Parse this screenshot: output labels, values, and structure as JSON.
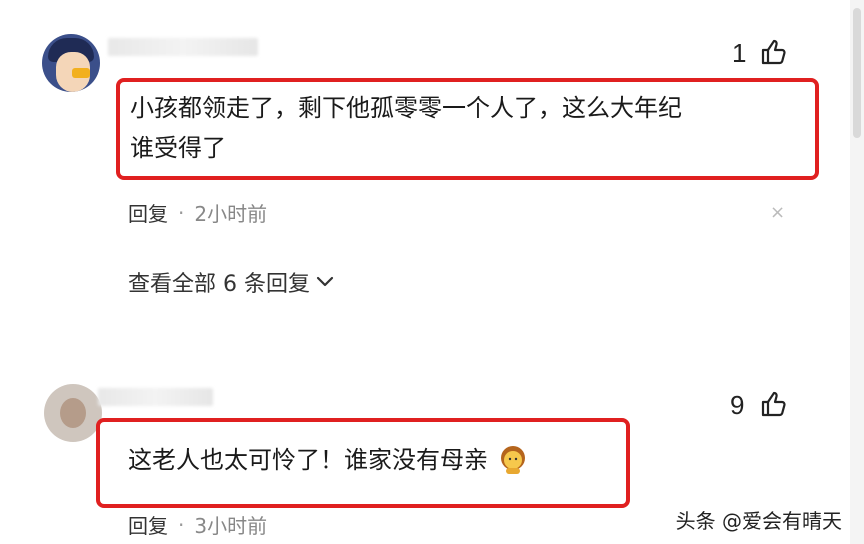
{
  "comments": [
    {
      "likes": "1",
      "text_line1": "小孩都领走了，剩下他孤零零一个人了，这么大年纪",
      "text_line2": "谁受得了",
      "reply_label": "回复",
      "separator": "·",
      "time": "2小时前",
      "close_icon": "×",
      "view_replies": "查看全部 6 条回复"
    },
    {
      "likes": "9",
      "text": "这老人也太可怜了！谁家没有母亲",
      "reply_label": "回复",
      "separator": "·",
      "time": "3小时前"
    }
  ],
  "watermark": "头条 @爱会有晴天",
  "colors": {
    "highlight_border": "#e02020",
    "text": "#1a1a1a",
    "muted": "#888888"
  }
}
